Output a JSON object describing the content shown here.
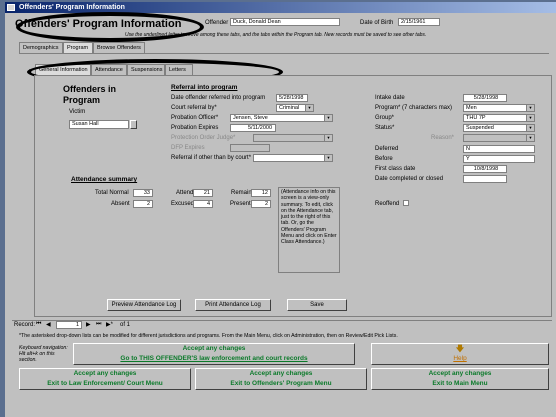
{
  "window": {
    "title": "Offenders' Program Information"
  },
  "header": {
    "form_title": "Offenders' Program Information",
    "offender_label": "Offender",
    "offender_value": "Duck, Donald Dean",
    "dob_label": "Date of Birth",
    "dob_value": "2/15/1961",
    "instructions": "Use the underlined letter to move among these tabs, and the tabs within the Program tab. New records must be saved to see other tabs."
  },
  "top_tabs": [
    "Demographics",
    "Program",
    "Browse Offenders"
  ],
  "sub_tabs": [
    "General Information",
    "Attendance",
    "Suspensions",
    "Letters"
  ],
  "program": {
    "section_title": "Offenders in Program",
    "victim_label": "Victim",
    "victim_value": "Susan Hall",
    "referral_title": "Referral into program",
    "referral_date_label": "Date offender referred into program",
    "referral_date_value": "5/28/1998",
    "court_label": "Court referral by*",
    "court_value": "Criminal",
    "po_label": "Probation Officer*",
    "po_value": "Jensen, Steve",
    "prob_exp_label": "Probation Expires",
    "prob_exp_value": "5/11/2000",
    "protection_label": "Protection Order Judge*",
    "dfp_label": "DFP Expires",
    "referral_other_label": "Referral if other than by court*"
  },
  "attendance": {
    "title": "Attendance summary",
    "total_normal_label": "Total Normal",
    "total_normal_value": "33",
    "attend_label": "Attend",
    "attend_value": "21",
    "remain_label": "Remain",
    "remain_value": "12",
    "absent_label": "Absent",
    "absent_value": "2",
    "excused_label": "Excused",
    "excused_value": "4",
    "present_label": "Present",
    "present_value": "2",
    "note": "(Attendance info on this screen is a view-only summary. To edit, click on the Attendance tab, just to the right of this tab. Or, go the Offenders' Program Menu and click on Enter Class Attendance.)"
  },
  "intake": {
    "intake_date_label": "Intake date",
    "intake_date_value": "5/28/1998",
    "program_label": "Program* (7 characters max)",
    "program_value": "Men",
    "group_label": "Group*",
    "group_value": "THU 7P",
    "status_label": "Status*",
    "status_value": "Suspended",
    "reason_label": "Reason*",
    "deferred_label": "Deferred",
    "deferred_value": "N",
    "before_label": "Before",
    "before_value": "Y",
    "first_class_label": "First class date",
    "first_class_value": "10/8/1998",
    "completed_label": "Date completed or closed",
    "refiled_label": "Reoffend"
  },
  "buttons": {
    "preview": "Preview Attendance Log",
    "print": "Print Attendance Log",
    "save": "Save"
  },
  "record_nav": {
    "label": "Record:",
    "current": "1",
    "of": "of 1"
  },
  "footer": {
    "asterisk_note": "*The asterisked drop-down lists can be modified for different jurisdictions and programs. From the Main Menu, click on Administration, then on Review/Edit Pick Lists.",
    "keyboard_note": "Keyboard navigation: Hit alt+k on this section.",
    "accept_line1": "Accept any changes",
    "goto_law": "Go to THIS OFFENDER'S law enforcement and court records",
    "help_label": "Help",
    "accept1": "Accept any changes",
    "exit_law": "Exit to Law Enforcement/ Court Menu",
    "accept2": "Accept any changes",
    "exit_prog": "Exit to Offenders' Program Menu",
    "accept3": "Accept any changes",
    "exit_main": "Exit to Main Menu"
  },
  "colors": {
    "accent_green": "#0b7a2a",
    "titlebar_blue": "#08246b"
  }
}
